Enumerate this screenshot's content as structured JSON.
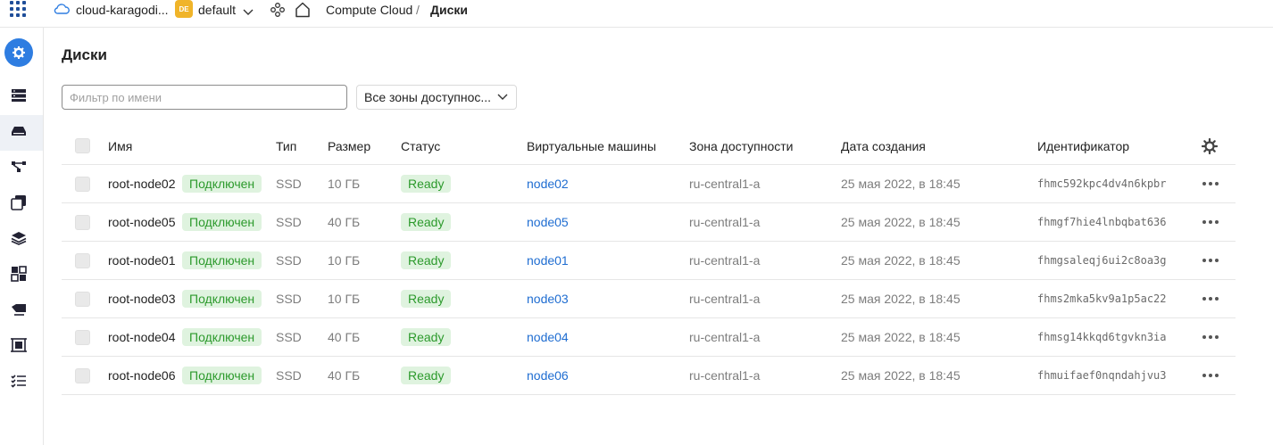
{
  "topbar": {
    "cloud_name": "cloud-karagodi...",
    "folder_badge": "DE",
    "folder_name": "default",
    "service": "Compute Cloud",
    "separator": "/",
    "page": "Диски"
  },
  "page": {
    "title": "Диски"
  },
  "filters": {
    "name_placeholder": "Фильтр по имени",
    "zone_select": "Все зоны доступнос..."
  },
  "table": {
    "columns": {
      "name": "Имя",
      "type": "Тип",
      "size": "Размер",
      "status": "Статус",
      "vms": "Виртуальные машины",
      "zone": "Зона доступности",
      "created": "Дата создания",
      "id": "Идентификатор"
    },
    "rows": [
      {
        "name": "root-node02",
        "attach": "Подключен",
        "type": "SSD",
        "size": "10 ГБ",
        "status": "Ready",
        "vm": "node02",
        "zone": "ru-central1-a",
        "created": "25 мая 2022, в 18:45",
        "id": "fhmc592kpc4dv4n6kpbr"
      },
      {
        "name": "root-node05",
        "attach": "Подключен",
        "type": "SSD",
        "size": "40 ГБ",
        "status": "Ready",
        "vm": "node05",
        "zone": "ru-central1-a",
        "created": "25 мая 2022, в 18:45",
        "id": "fhmgf7hie4lnbqbat636"
      },
      {
        "name": "root-node01",
        "attach": "Подключен",
        "type": "SSD",
        "size": "10 ГБ",
        "status": "Ready",
        "vm": "node01",
        "zone": "ru-central1-a",
        "created": "25 мая 2022, в 18:45",
        "id": "fhmgsaleqj6ui2c8oa3g"
      },
      {
        "name": "root-node03",
        "attach": "Подключен",
        "type": "SSD",
        "size": "10 ГБ",
        "status": "Ready",
        "vm": "node03",
        "zone": "ru-central1-a",
        "created": "25 мая 2022, в 18:45",
        "id": "fhms2mka5kv9a1p5ac22"
      },
      {
        "name": "root-node04",
        "attach": "Подключен",
        "type": "SSD",
        "size": "40 ГБ",
        "status": "Ready",
        "vm": "node04",
        "zone": "ru-central1-a",
        "created": "25 мая 2022, в 18:45",
        "id": "fhmsg14kkqd6tgvkn3ia"
      },
      {
        "name": "root-node06",
        "attach": "Подключен",
        "type": "SSD",
        "size": "40 ГБ",
        "status": "Ready",
        "vm": "node06",
        "zone": "ru-central1-a",
        "created": "25 мая 2022, в 18:45",
        "id": "fhmuifaef0nqndahjvu3"
      }
    ]
  },
  "icons": {
    "apps": "apps-grid-icon",
    "cloud": "cloud-icon",
    "chevron": "chevron-down-icon",
    "hub": "hub-icon",
    "home": "home-icon",
    "settings": "gear-icon",
    "row_menu": "more-horizontal-icon",
    "sidebar": [
      "compute-cloud-icon",
      "servers-icon",
      "disks-icon",
      "network-icon",
      "images-icon",
      "layers-icon",
      "groups-icon",
      "snapshot-icon",
      "placement-icon",
      "tasks-icon"
    ]
  },
  "colors": {
    "accent": "#2e7de1",
    "link": "#1f6dd1",
    "ready_bg": "#dff3df",
    "ready_text": "#2c9a2c",
    "folder_badge": "#f0b429"
  }
}
